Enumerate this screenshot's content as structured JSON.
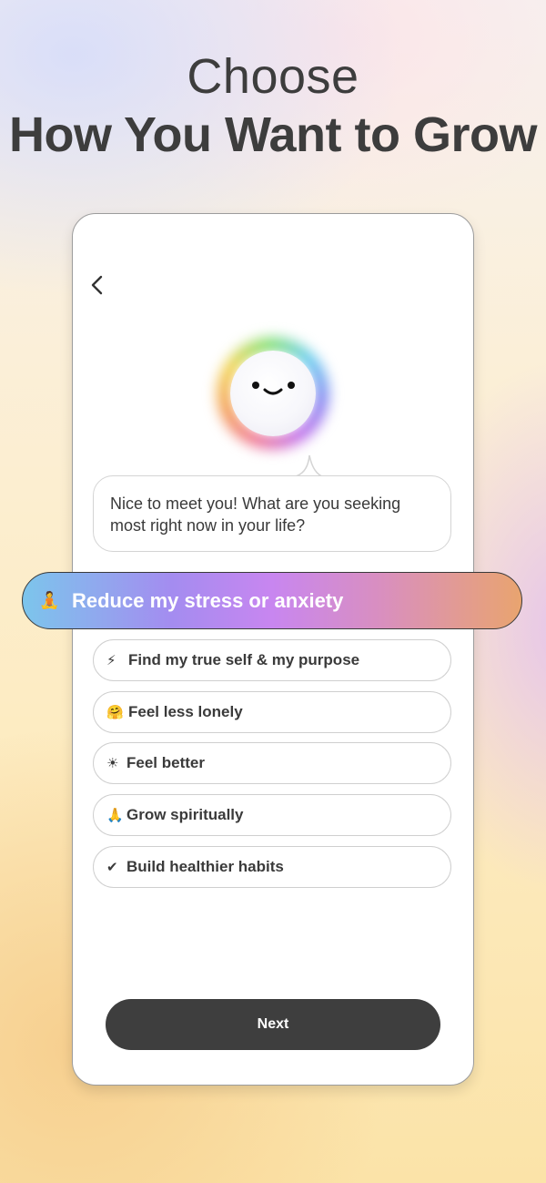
{
  "headline": {
    "line1": "Choose",
    "line2": "How You Want to Grow"
  },
  "screen": {
    "back_icon": "chevron-left-icon",
    "avatar": "smiling-orb",
    "message": "Nice to meet you! What are you seeking most right now in your life?",
    "selected_option": {
      "emoji": "🧘",
      "label": "Reduce my stress or anxiety"
    },
    "options": [
      {
        "emoji": "⚡",
        "label": "Find my true self & my purpose"
      },
      {
        "emoji": "🤗",
        "label": "Feel less lonely"
      },
      {
        "emoji": "☀",
        "label": "Feel better"
      },
      {
        "emoji": "🙏",
        "label": "Grow spiritually"
      },
      {
        "emoji": "✔",
        "label": "Build healthier habits"
      }
    ],
    "next_label": "Next"
  },
  "colors": {
    "text_dark": "#3d3d3d",
    "button_bg": "#3e3e3e",
    "selected_gradient": [
      "#7cc5ec",
      "#c886f0",
      "#e9a46f"
    ]
  }
}
